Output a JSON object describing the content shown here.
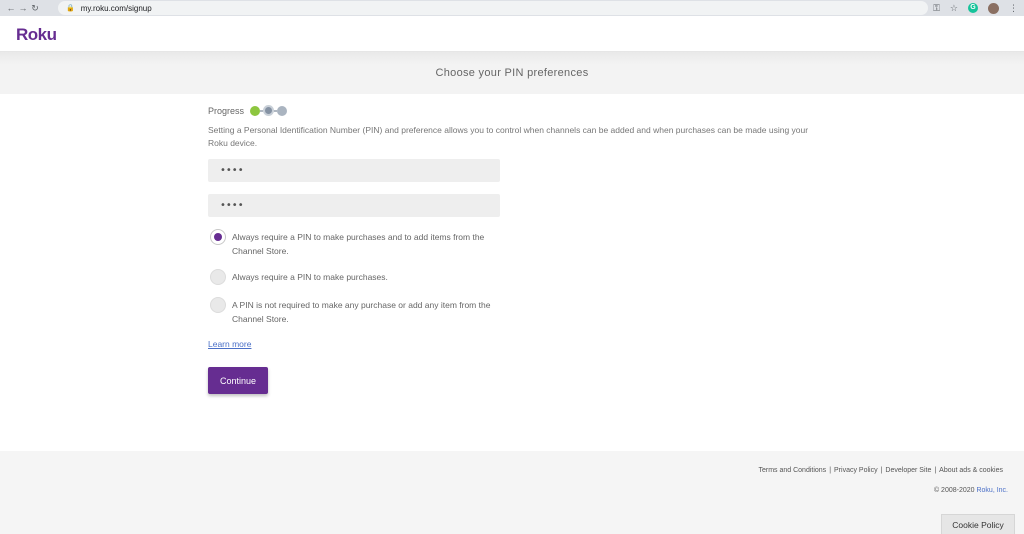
{
  "browser": {
    "url": "my.roku.com/signup",
    "ext_label": "G"
  },
  "header": {
    "logo": "Roku"
  },
  "page": {
    "title": "Choose your PIN preferences"
  },
  "progress": {
    "label": "Progress",
    "steps": [
      "done",
      "current",
      "todo"
    ]
  },
  "form": {
    "description": "Setting a Personal Identification Number (PIN) and preference allows you to control when channels can be added and when purchases can be made using your Roku device.",
    "pin_value": "••••",
    "pin_confirm_value": "••••",
    "options": [
      {
        "label": "Always require a PIN to make purchases and to add items from the Channel Store.",
        "selected": true
      },
      {
        "label": "Always require a PIN to make purchases.",
        "selected": false
      },
      {
        "label": "A PIN is not required to make any purchase or add any item from the Channel Store.",
        "selected": false
      }
    ],
    "learn_more": "Learn more",
    "continue_label": "Continue"
  },
  "footer": {
    "links": [
      "Terms and Conditions",
      "Privacy Policy",
      "Developer Site",
      "About ads & cookies"
    ],
    "separator": "|",
    "copyright_prefix": "© 2008-2020 ",
    "copyright_company": "Roku, Inc.",
    "cookie_policy": "Cookie Policy"
  },
  "colors": {
    "brand": "#662d91",
    "progress_done": "#8dc63f",
    "link": "#4a6fc7"
  }
}
